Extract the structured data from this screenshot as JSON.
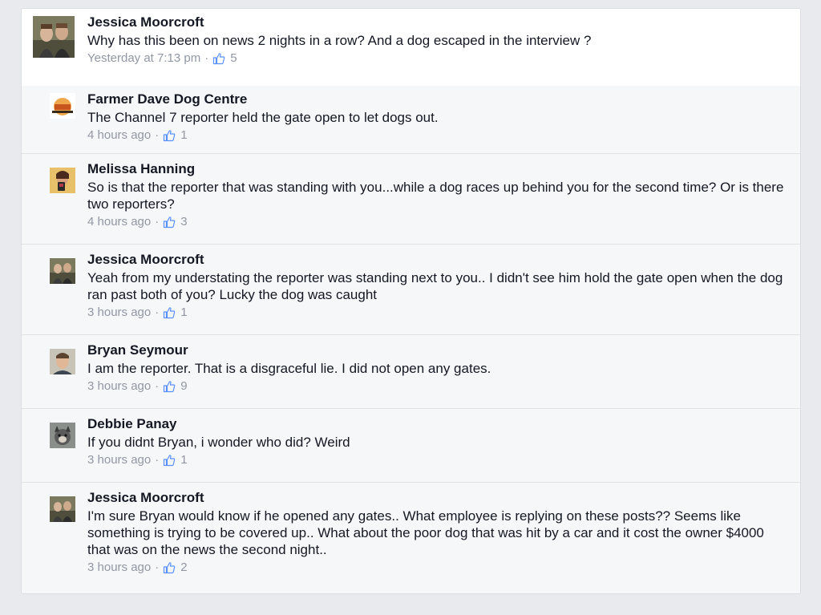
{
  "comments": [
    {
      "name": "Jessica Moorcroft",
      "text": "Why has this been on news 2 nights in a row? And a dog escaped in the interview ?",
      "time": "Yesterday at 7:13 pm",
      "likes": "5"
    },
    {
      "name": "Farmer Dave Dog Centre",
      "text": "The Channel 7 reporter held the gate open to let dogs out.",
      "time": "4 hours ago",
      "likes": "1"
    },
    {
      "name": "Melissa Hanning",
      "text": "So is that the reporter that was standing with you...while a dog races up behind you for the second time? Or is there two reporters?",
      "time": "4 hours ago",
      "likes": "3"
    },
    {
      "name": "Jessica Moorcroft",
      "text": "Yeah from my understating the reporter was standing next to you.. I didn't see him hold the gate open when the dog ran past both of you? Lucky the dog was caught",
      "time": "3 hours ago",
      "likes": "1"
    },
    {
      "name": "Bryan Seymour",
      "text": "I am the reporter. That is a disgraceful lie. I did not open any gates.",
      "time": "3 hours ago",
      "likes": "9"
    },
    {
      "name": "Debbie Panay",
      "text": "If you didnt Bryan, i wonder who did? Weird",
      "time": "3 hours ago",
      "likes": "1"
    },
    {
      "name": "Jessica Moorcroft",
      "text": "I'm sure Bryan would know if he opened any gates.. What employee is replying on these posts?? Seems like something is trying to be covered up.. What about the poor dog that was hit by a car and it cost the owner $4000 that was on the news the second night..",
      "time": "3 hours ago",
      "likes": "2"
    }
  ],
  "separator": "·",
  "colors": {
    "name": "#141823",
    "meta": "#9197a3",
    "like_icon": "#5890ff",
    "background": "#e9eaed",
    "top_comment_bg": "#ffffff",
    "reply_bg": "#f6f7f8"
  },
  "icons": {
    "like": "thumbs-up-icon"
  }
}
